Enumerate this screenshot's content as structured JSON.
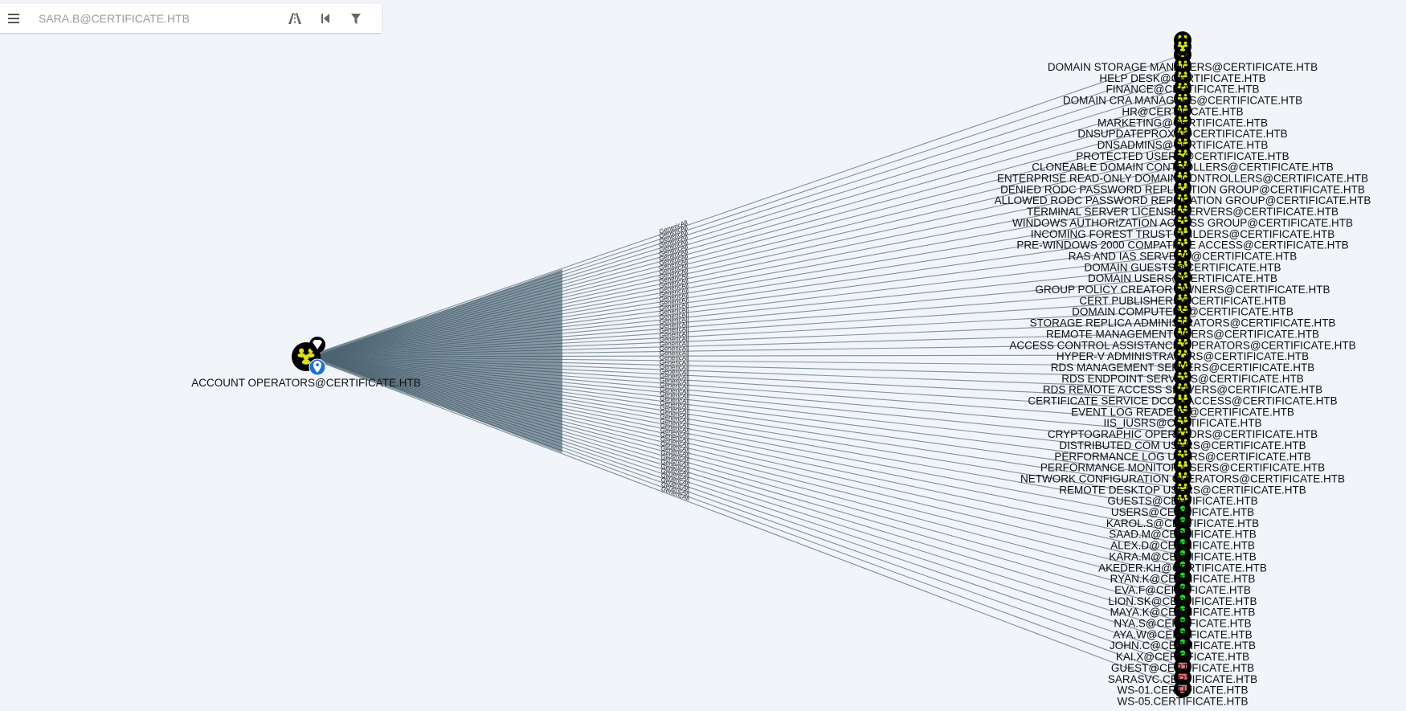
{
  "search": {
    "placeholder": "SARA.B@CERTIFICATE.HTB"
  },
  "toolbar": {
    "menu_icon": "hamburger-icon",
    "path_icon": "pathfinding-icon",
    "back_icon": "back-icon",
    "filter_icon": "filter-icon"
  },
  "graph": {
    "source": {
      "label": "ACCOUNT OPERATORS@CERTIFICATE.HTB",
      "type": "group",
      "badges": [
        "high-value-icon",
        "owned-icon"
      ]
    },
    "edge_label": "GenericAll",
    "targets": [
      {
        "label": "DOMAIN STORAGE MANAGERS@CERTIFICATE.HTB",
        "type": "group"
      },
      {
        "label": "HELP DESK@CERTIFICATE.HTB",
        "type": "group"
      },
      {
        "label": "FINANCE@CERTIFICATE.HTB",
        "type": "group"
      },
      {
        "label": "DOMAIN CRA MANAGERS@CERTIFICATE.HTB",
        "type": "group"
      },
      {
        "label": "HR@CERTIFICATE.HTB",
        "type": "group"
      },
      {
        "label": "MARKETING@CERTIFICATE.HTB",
        "type": "group"
      },
      {
        "label": "DNSUPDATEPROXY@CERTIFICATE.HTB",
        "type": "group"
      },
      {
        "label": "DNSADMINS@CERTIFICATE.HTB",
        "type": "group"
      },
      {
        "label": "PROTECTED USERS@CERTIFICATE.HTB",
        "type": "group"
      },
      {
        "label": "CLONEABLE DOMAIN CONTROLLERS@CERTIFICATE.HTB",
        "type": "group"
      },
      {
        "label": "ENTERPRISE READ-ONLY DOMAIN CONTROLLERS@CERTIFICATE.HTB",
        "type": "group"
      },
      {
        "label": "DENIED RODC PASSWORD REPLICATION GROUP@CERTIFICATE.HTB",
        "type": "group"
      },
      {
        "label": "ALLOWED RODC PASSWORD REPLICATION GROUP@CERTIFICATE.HTB",
        "type": "group"
      },
      {
        "label": "TERMINAL SERVER LICENSE SERVERS@CERTIFICATE.HTB",
        "type": "group"
      },
      {
        "label": "WINDOWS AUTHORIZATION ACCESS GROUP@CERTIFICATE.HTB",
        "type": "group"
      },
      {
        "label": "INCOMING FOREST TRUST BUILDERS@CERTIFICATE.HTB",
        "type": "group"
      },
      {
        "label": "PRE-WINDOWS 2000 COMPATIBLE ACCESS@CERTIFICATE.HTB",
        "type": "group"
      },
      {
        "label": "RAS AND IAS SERVERS@CERTIFICATE.HTB",
        "type": "group"
      },
      {
        "label": "DOMAIN GUESTS@CERTIFICATE.HTB",
        "type": "group"
      },
      {
        "label": "DOMAIN USERS@CERTIFICATE.HTB",
        "type": "group"
      },
      {
        "label": "GROUP POLICY CREATOR OWNERS@CERTIFICATE.HTB",
        "type": "group"
      },
      {
        "label": "CERT PUBLISHERS@CERTIFICATE.HTB",
        "type": "group"
      },
      {
        "label": "DOMAIN COMPUTERS@CERTIFICATE.HTB",
        "type": "group"
      },
      {
        "label": "STORAGE REPLICA ADMINISTRATORS@CERTIFICATE.HTB",
        "type": "group"
      },
      {
        "label": "REMOTE MANAGEMENT USERS@CERTIFICATE.HTB",
        "type": "group"
      },
      {
        "label": "ACCESS CONTROL ASSISTANCE OPERATORS@CERTIFICATE.HTB",
        "type": "group"
      },
      {
        "label": "HYPER-V ADMINISTRATORS@CERTIFICATE.HTB",
        "type": "group"
      },
      {
        "label": "RDS MANAGEMENT SERVERS@CERTIFICATE.HTB",
        "type": "group"
      },
      {
        "label": "RDS ENDPOINT SERVERS@CERTIFICATE.HTB",
        "type": "group"
      },
      {
        "label": "RDS REMOTE ACCESS SERVERS@CERTIFICATE.HTB",
        "type": "group"
      },
      {
        "label": "CERTIFICATE SERVICE DCOM ACCESS@CERTIFICATE.HTB",
        "type": "group"
      },
      {
        "label": "EVENT LOG READERS@CERTIFICATE.HTB",
        "type": "group"
      },
      {
        "label": "IIS_IUSRS@CERTIFICATE.HTB",
        "type": "group"
      },
      {
        "label": "CRYPTOGRAPHIC OPERATORS@CERTIFICATE.HTB",
        "type": "group"
      },
      {
        "label": "DISTRIBUTED COM USERS@CERTIFICATE.HTB",
        "type": "group"
      },
      {
        "label": "PERFORMANCE LOG USERS@CERTIFICATE.HTB",
        "type": "group"
      },
      {
        "label": "PERFORMANCE MONITOR USERS@CERTIFICATE.HTB",
        "type": "group"
      },
      {
        "label": "NETWORK CONFIGURATION OPERATORS@CERTIFICATE.HTB",
        "type": "group"
      },
      {
        "label": "REMOTE DESKTOP USERS@CERTIFICATE.HTB",
        "type": "group"
      },
      {
        "label": "GUESTS@CERTIFICATE.HTB",
        "type": "group"
      },
      {
        "label": "USERS@CERTIFICATE.HTB",
        "type": "group"
      },
      {
        "label": "KAROL.S@CERTIFICATE.HTB",
        "type": "user"
      },
      {
        "label": "SAAD.M@CERTIFICATE.HTB",
        "type": "user"
      },
      {
        "label": "ALEX.D@CERTIFICATE.HTB",
        "type": "user"
      },
      {
        "label": "KARA.M@CERTIFICATE.HTB",
        "type": "user"
      },
      {
        "label": "AKEDER.KH@CERTIFICATE.HTB",
        "type": "user"
      },
      {
        "label": "RYAN.K@CERTIFICATE.HTB",
        "type": "user"
      },
      {
        "label": "EVA.F@CERTIFICATE.HTB",
        "type": "user"
      },
      {
        "label": "LION.SK@CERTIFICATE.HTB",
        "type": "user"
      },
      {
        "label": "MAYA.K@CERTIFICATE.HTB",
        "type": "user"
      },
      {
        "label": "NYA.S@CERTIFICATE.HTB",
        "type": "user"
      },
      {
        "label": "AYA.W@CERTIFICATE.HTB",
        "type": "user"
      },
      {
        "label": "JOHN.C@CERTIFICATE.HTB",
        "type": "user"
      },
      {
        "label": "KAI.X@CERTIFICATE.HTB",
        "type": "user"
      },
      {
        "label": "GUEST@CERTIFICATE.HTB",
        "type": "user"
      },
      {
        "label": "SARASVC.CERTIFICATE.HTB",
        "type": "computer"
      },
      {
        "label": "WS-01.CERTIFICATE.HTB",
        "type": "computer"
      },
      {
        "label": "WS-05.CERTIFICATE.HTB",
        "type": "computer"
      }
    ]
  },
  "colors": {
    "group": "#d8df21",
    "user": "#17e625",
    "computer": "#e67873",
    "edge": "#6f7f8a",
    "edge_dense": "#2e4a5c",
    "background": "#f1f4f9"
  }
}
